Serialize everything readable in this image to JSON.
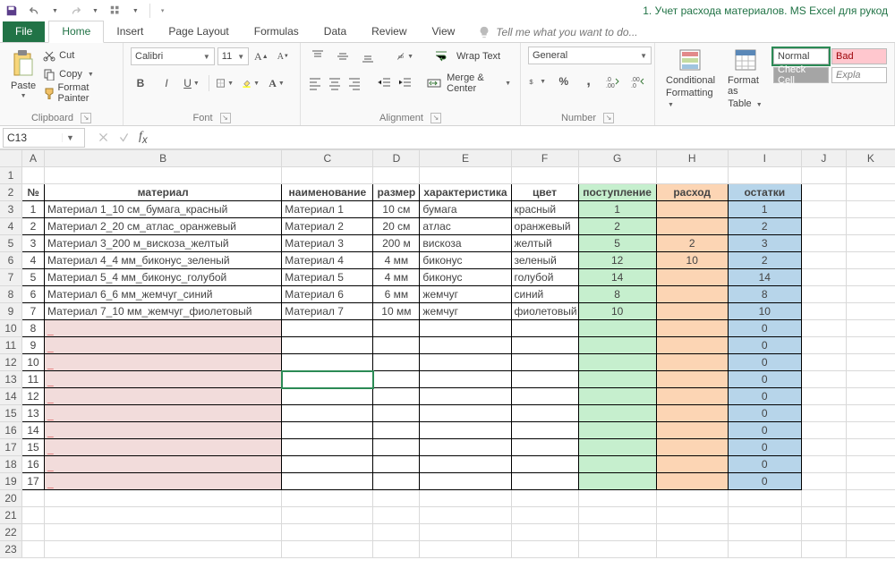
{
  "title": "1. Учет расхода материалов. MS Excel для рукод",
  "qat": {
    "save": "save",
    "undo": "undo",
    "redo": "redo",
    "custom": "custom"
  },
  "tabs": {
    "file": "File",
    "home": "Home",
    "insert": "Insert",
    "page_layout": "Page Layout",
    "formulas": "Formulas",
    "data": "Data",
    "review": "Review",
    "view": "View",
    "tell": "Tell me what you want to do..."
  },
  "clipboard": {
    "paste": "Paste",
    "cut": "Cut",
    "copy": "Copy",
    "fp": "Format Painter",
    "label": "Clipboard"
  },
  "font": {
    "name": "Calibri",
    "size": "11",
    "label": "Font"
  },
  "alignment": {
    "wrap": "Wrap Text",
    "merge": "Merge & Center",
    "label": "Alignment"
  },
  "number": {
    "fmt": "General",
    "label": "Number"
  },
  "styles_grp": {
    "cond": "Conditional",
    "cond2": "Formatting",
    "fmt_as": "Format as",
    "fmt_as2": "Table",
    "normal": "Normal",
    "bad": "Bad",
    "check": "Check Cell",
    "expl": "Expla"
  },
  "namebox": "C13",
  "headers": {
    "A": "№",
    "B": "материал",
    "C": "наименование",
    "D": "размер",
    "E": "характеристика",
    "F": "цвет",
    "G": "поступление",
    "H": "расход",
    "I": "остатки"
  },
  "cols": [
    "A",
    "B",
    "C",
    "D",
    "E",
    "F",
    "G",
    "H",
    "I",
    "J",
    "K"
  ],
  "rows": [
    {
      "n": "1",
      "mat": "Материал 1_10 см_бумага_красный",
      "nm": "Материал 1",
      "sz": "10 см",
      "ch": "бумага",
      "cl": "красный",
      "pg": "1",
      "ras": "",
      "ost": "1"
    },
    {
      "n": "2",
      "mat": "Материал 2_20 см_атлас_оранжевый",
      "nm": "Материал 2",
      "sz": "20 см",
      "ch": "атлас",
      "cl": "оранжевый",
      "pg": "2",
      "ras": "",
      "ost": "2"
    },
    {
      "n": "3",
      "mat": "Материал 3_200 м_вискоза_желтый",
      "nm": "Материал 3",
      "sz": "200 м",
      "ch": "вискоза",
      "cl": "желтый",
      "pg": "5",
      "ras": "2",
      "ost": "3"
    },
    {
      "n": "4",
      "mat": "Материал 4_4 мм_биконус_зеленый",
      "nm": "Материал 4",
      "sz": "4 мм",
      "ch": "биконус",
      "cl": "зеленый",
      "pg": "12",
      "ras": "10",
      "ost": "2"
    },
    {
      "n": "5",
      "mat": "Материал 5_4 мм_биконус_голубой",
      "nm": "Материал 5",
      "sz": "4 мм",
      "ch": "биконус",
      "cl": "голубой",
      "pg": "14",
      "ras": "",
      "ost": "14"
    },
    {
      "n": "6",
      "mat": "Материал 6_6 мм_жемчуг_синий",
      "nm": "Материал 6",
      "sz": "6 мм",
      "ch": "жемчуг",
      "cl": "синий",
      "pg": "8",
      "ras": "",
      "ost": "8"
    },
    {
      "n": "7",
      "mat": "Материал 7_10 мм_жемчуг_фиолетовый",
      "nm": "Материал 7",
      "sz": "10 мм",
      "ch": "жемчуг",
      "cl": "фиолетовый",
      "pg": "10",
      "ras": "",
      "ost": "10"
    },
    {
      "n": "8",
      "mat": "",
      "nm": "",
      "sz": "",
      "ch": "",
      "cl": "",
      "pg": "",
      "ras": "",
      "ost": "0"
    },
    {
      "n": "9",
      "mat": "",
      "nm": "",
      "sz": "",
      "ch": "",
      "cl": "",
      "pg": "",
      "ras": "",
      "ost": "0"
    },
    {
      "n": "10",
      "mat": "",
      "nm": "",
      "sz": "",
      "ch": "",
      "cl": "",
      "pg": "",
      "ras": "",
      "ost": "0"
    },
    {
      "n": "11",
      "mat": "",
      "nm": "",
      "sz": "",
      "ch": "",
      "cl": "",
      "pg": "",
      "ras": "",
      "ost": "0"
    },
    {
      "n": "12",
      "mat": "",
      "nm": "",
      "sz": "",
      "ch": "",
      "cl": "",
      "pg": "",
      "ras": "",
      "ost": "0"
    },
    {
      "n": "13",
      "mat": "",
      "nm": "",
      "sz": "",
      "ch": "",
      "cl": "",
      "pg": "",
      "ras": "",
      "ost": "0"
    },
    {
      "n": "14",
      "mat": "",
      "nm": "",
      "sz": "",
      "ch": "",
      "cl": "",
      "pg": "",
      "ras": "",
      "ost": "0"
    },
    {
      "n": "15",
      "mat": "",
      "nm": "",
      "sz": "",
      "ch": "",
      "cl": "",
      "pg": "",
      "ras": "",
      "ost": "0"
    },
    {
      "n": "16",
      "mat": "",
      "nm": "",
      "sz": "",
      "ch": "",
      "cl": "",
      "pg": "",
      "ras": "",
      "ost": "0"
    },
    {
      "n": "17",
      "mat": "",
      "nm": "",
      "sz": "",
      "ch": "",
      "cl": "",
      "pg": "",
      "ras": "",
      "ost": "0"
    }
  ],
  "extra_rows": [
    "20",
    "21",
    "22",
    "23"
  ]
}
